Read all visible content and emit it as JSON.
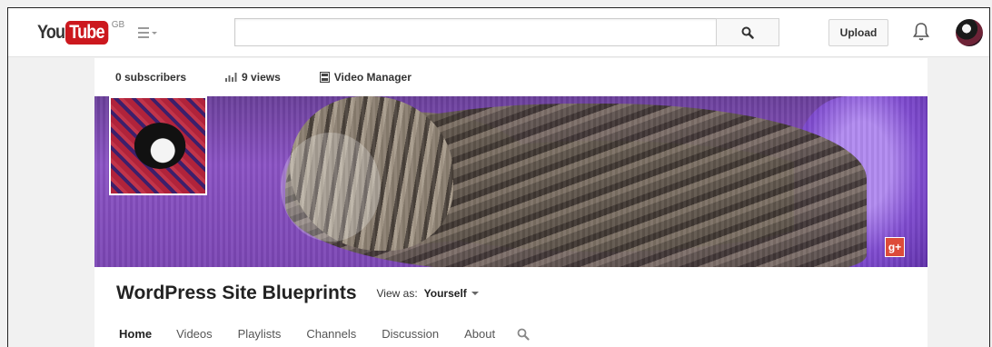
{
  "masthead": {
    "logo_you": "You",
    "logo_tube": "Tube",
    "logo_region": "GB",
    "search_value": "",
    "search_placeholder": "",
    "upload_label": "Upload"
  },
  "stats": {
    "subscribers": "0 subscribers",
    "views": "9 views",
    "video_manager": "Video Manager"
  },
  "channel": {
    "title": "WordPress Site Blueprints",
    "view_as_label": "View as:",
    "view_as_value": "Yourself",
    "gplus_label": "g+"
  },
  "tabs": [
    {
      "label": "Home",
      "active": true
    },
    {
      "label": "Videos"
    },
    {
      "label": "Playlists"
    },
    {
      "label": "Channels"
    },
    {
      "label": "Discussion"
    },
    {
      "label": "About"
    }
  ],
  "icons": [
    "guide-menu-icon",
    "search-icon",
    "bell-icon",
    "bar-chart-icon",
    "film-icon",
    "chevron-down-icon",
    "google-plus-icon"
  ],
  "colors": {
    "brand_red": "#cc181e",
    "banner_purple": "#7b46b4",
    "gplus_red": "#dd4b39"
  }
}
